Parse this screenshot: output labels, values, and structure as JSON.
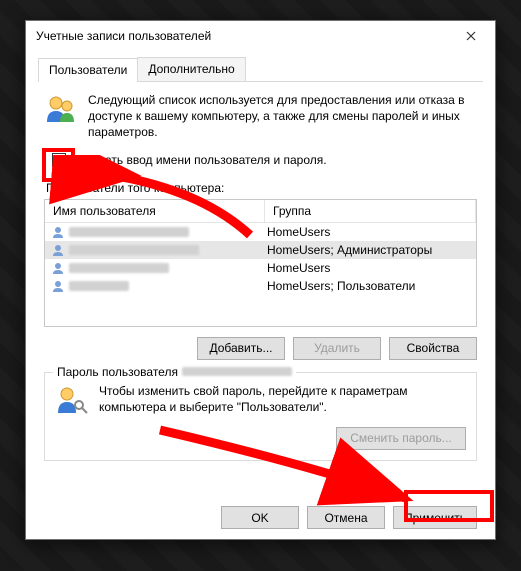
{
  "window": {
    "title": "Учетные записи пользователей"
  },
  "tabs": {
    "users": "Пользователи",
    "advanced": "Дополнительно"
  },
  "intro": "Следующий список используется для предоставления или отказа в доступе к вашему компьютеру, а также для смены паролей и иных параметров.",
  "checkbox": {
    "label": " ребовать ввод имени пользователя и пароля.",
    "checked": true
  },
  "users_section": {
    "label": "Пользователи  того компьютера:",
    "cols": {
      "name": "Имя пользователя",
      "group": "Группа"
    },
    "rows": [
      {
        "group": "HomeUsers",
        "selected": false
      },
      {
        "group": "HomeUsers; Администраторы",
        "selected": true
      },
      {
        "group": "HomeUsers",
        "selected": false
      },
      {
        "group": "HomeUsers; Пользователи",
        "selected": false
      }
    ]
  },
  "user_buttons": {
    "add": "Добавить...",
    "remove": "Удалить",
    "props": "Свойства"
  },
  "password_group": {
    "title": "Пароль пользователя",
    "text": "Чтобы изменить свой пароль, перейдите к параметрам компьютера и выберите \"Пользователи\".",
    "change_btn": "Сменить пароль..."
  },
  "dialog_buttons": {
    "ok": "OK",
    "cancel": "Отмена",
    "apply": "Применить"
  }
}
